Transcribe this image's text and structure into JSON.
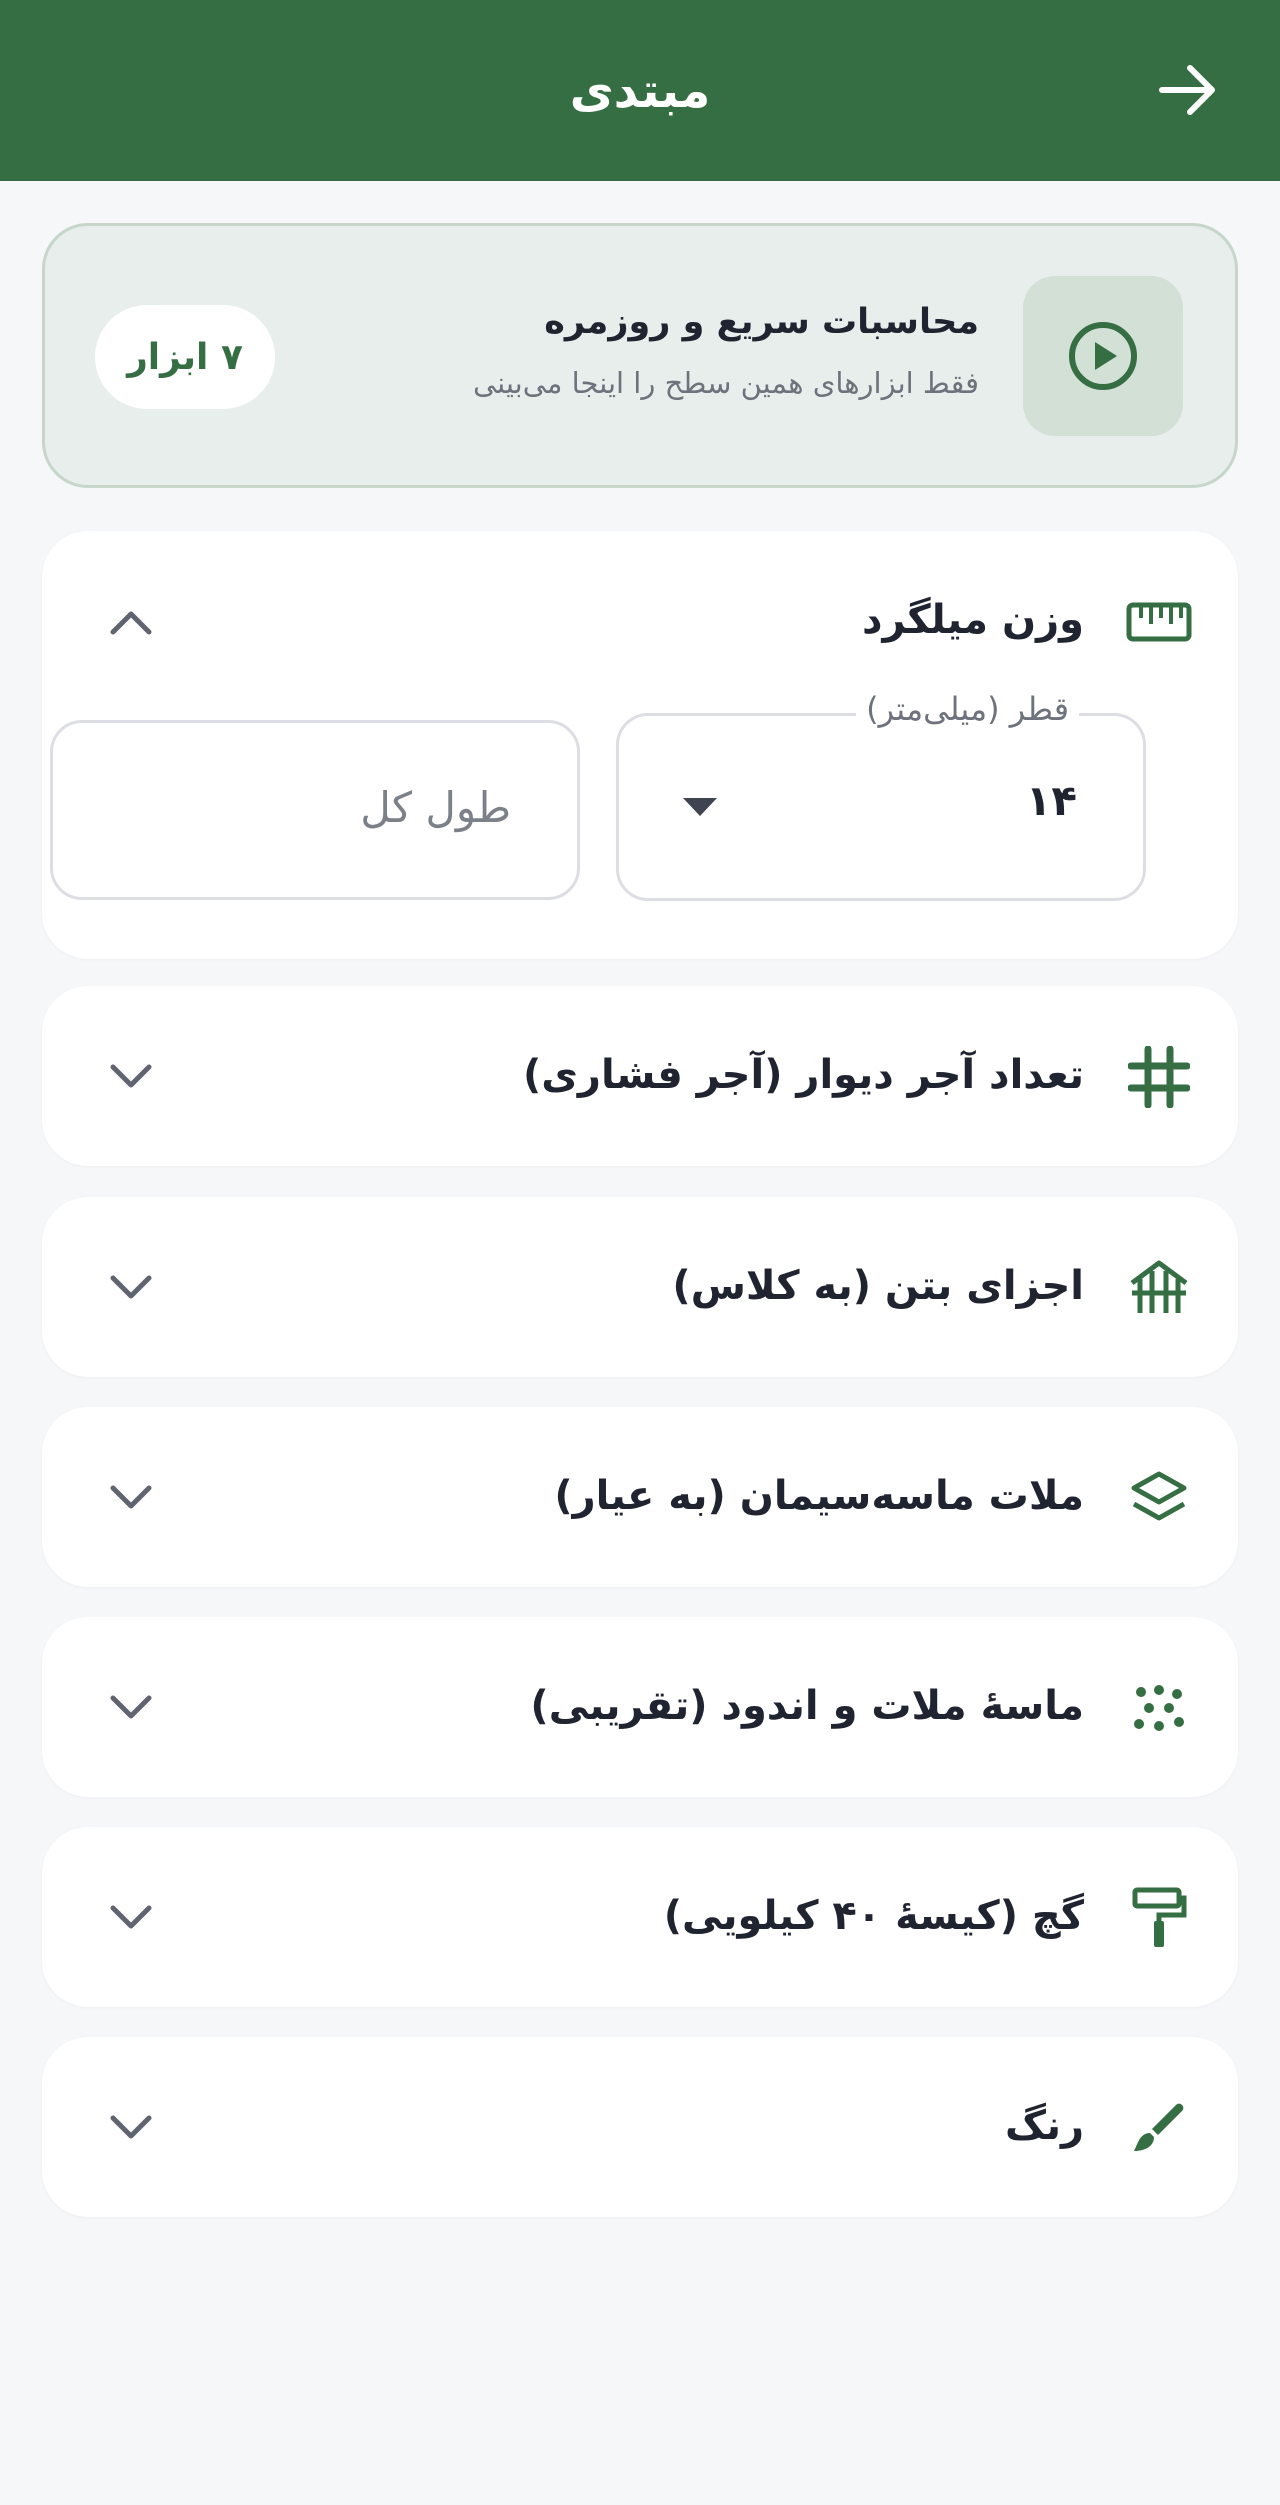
{
  "appbar": {
    "title": "مبتدی",
    "back_icon": "arrow-right-icon",
    "background": "#366e43"
  },
  "banner": {
    "icon": "play-circle-icon",
    "title": "محاسبات سریع و روزمره",
    "subtitle": "فقط ابزارهای همین سطح را اینجا می‌بینی",
    "badge": "۷ ابزار"
  },
  "tools": [
    {
      "title": "وزن میلگرد",
      "icon": "ruler-icon",
      "expanded": true,
      "diameter_label": "قطر (میلی‌متر)",
      "diameter_value": "۱۴",
      "length_placeholder": "طول کل"
    },
    {
      "title": "تعداد آجر دیوار (آجر فشاری)",
      "icon": "grid-icon",
      "expanded": false
    },
    {
      "title": "اجزای بتن (به کلاس)",
      "icon": "building-icon",
      "expanded": false
    },
    {
      "title": "ملات ماسه‌سیمان (به عیار)",
      "icon": "layers-icon",
      "expanded": false
    },
    {
      "title": "ماسهٔ ملات و اندود (تقریبی)",
      "icon": "dots-icon",
      "expanded": false
    },
    {
      "title": "گچ (کیسهٔ ۴۰ کیلویی)",
      "icon": "paint-roller-icon",
      "expanded": false
    },
    {
      "title": "رنگ",
      "icon": "brush-icon",
      "expanded": false
    }
  ],
  "colors": {
    "accent": "#366e43",
    "background": "#f6f7f9",
    "card": "#ffffff",
    "banner_bg": "#e8eeeb"
  }
}
